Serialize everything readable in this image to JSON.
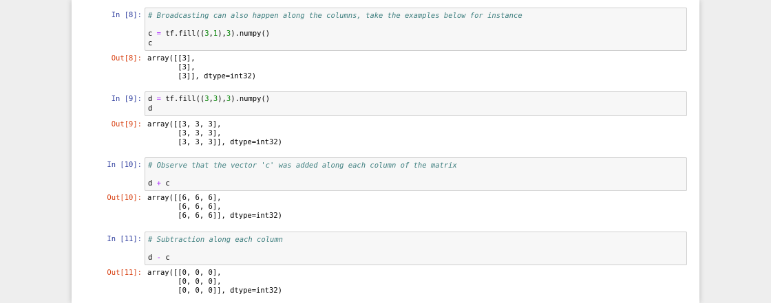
{
  "cells": [
    {
      "in_prompt": "In [8]:",
      "comment": "# Broadcasting can also happen along the columns, take the examples below for instance",
      "line1": {
        "var": "c",
        "op": "=",
        "pre": "tf.fill((",
        "n1": "3",
        "c1": ",",
        "n2": "1",
        "mid": "),",
        "n3": "3",
        "post": ").numpy()"
      },
      "line2": "c",
      "out_prompt": "Out[8]:",
      "output": [
        "array([[3],",
        "       [3],",
        "       [3]], dtype=int32)"
      ]
    },
    {
      "in_prompt": "In [9]:",
      "line1": {
        "var": "d",
        "op": "=",
        "pre": "tf.fill((",
        "n1": "3",
        "c1": ",",
        "n2": "3",
        "mid": "),",
        "n3": "3",
        "post": ").numpy()"
      },
      "line2": "d",
      "out_prompt": "Out[9]:",
      "output": [
        "array([[3, 3, 3],",
        "       [3, 3, 3],",
        "       [3, 3, 3]], dtype=int32)"
      ]
    },
    {
      "in_prompt": "In [10]:",
      "comment": "# Observe that the vector 'c' was added along each column of the matrix",
      "expr": {
        "left": "d",
        "op": "+",
        "right": "c"
      },
      "out_prompt": "Out[10]:",
      "output": [
        "array([[6, 6, 6],",
        "       [6, 6, 6],",
        "       [6, 6, 6]], dtype=int32)"
      ]
    },
    {
      "in_prompt": "In [11]:",
      "comment": "# Subtraction along each column",
      "expr": {
        "left": "d",
        "op": "-",
        "right": "c"
      },
      "out_prompt": "Out[11]:",
      "output": [
        "array([[0, 0, 0],",
        "       [0, 0, 0],",
        "       [0, 0, 0]], dtype=int32)"
      ]
    }
  ]
}
